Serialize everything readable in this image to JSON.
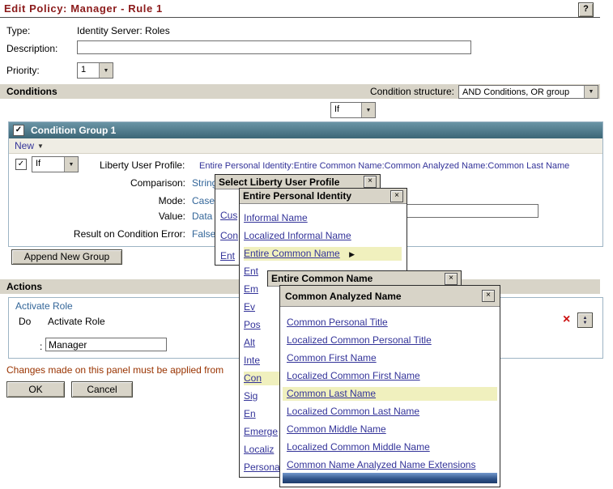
{
  "page": {
    "title": "Edit Policy: Manager - Rule 1"
  },
  "icons": {
    "help": "?",
    "close": "×",
    "dropdown": "▼",
    "submenu": "▶",
    "check": "✓",
    "delete": "×",
    "up": "▲",
    "down": "▼",
    "menu": "▼"
  },
  "form": {
    "type_label": "Type:",
    "type_value": "Identity Server: Roles",
    "description_label": "Description:",
    "description_value": "",
    "priority_label": "Priority:",
    "priority_value": "1"
  },
  "conditions": {
    "bar_label": "Conditions",
    "structure_label": "Condition structure:",
    "structure_value": "AND Conditions, OR group",
    "if_select": "If",
    "group": {
      "title": "Condition Group 1",
      "new_label": "New",
      "if_select": "If",
      "profile_label": "Liberty User Profile:",
      "profile_value": "Entire Personal Identity:Entire Common Name:Common Analyzed Name:Common Last Name",
      "comparison_label": "Comparison:",
      "comparison_value": "String",
      "mode_label": "Mode:",
      "mode_value": "Case S",
      "value_label": "Value:",
      "value_value": "Data E",
      "value_input": "",
      "error_label": "Result on Condition Error:",
      "error_value": "False"
    },
    "append_button": "Append New Group"
  },
  "actions": {
    "bar_label": "Actions",
    "panel_title": "Activate Role",
    "do_label": "Do",
    "do_value": "Activate Role",
    "param_label": ":",
    "param_value": "Manager"
  },
  "footer": {
    "note": "Changes made on this panel must be applied from",
    "ok_button": "OK",
    "cancel_button": "Cancel"
  },
  "popups": {
    "profile": {
      "title": "Select Liberty User Profile",
      "items": [
        {
          "label": "Cus"
        },
        {
          "label": "Con"
        },
        {
          "label": "Ent"
        }
      ]
    },
    "personal_identity": {
      "title": "Entire Personal Identity",
      "items": [
        {
          "label": "Informal Name"
        },
        {
          "label": "Localized Informal Name"
        },
        {
          "label": "Entire Common Name",
          "highlighted": true,
          "has_submenu": true
        },
        {
          "label": "Ent"
        },
        {
          "label": "Em"
        },
        {
          "label": "Ev"
        },
        {
          "label": "Pos"
        },
        {
          "label": "Alt"
        },
        {
          "label": "Inte"
        },
        {
          "label": "Con",
          "highlighted": true
        },
        {
          "label": "Sig"
        },
        {
          "label": "En"
        },
        {
          "label": "Emerge"
        },
        {
          "label": "Localiz"
        },
        {
          "label": "Persona"
        }
      ]
    },
    "common_name": {
      "title": "Entire Common Name"
    },
    "analyzed_name": {
      "title": "Common Analyzed Name",
      "items": [
        {
          "label": "Common Personal Title"
        },
        {
          "label": "Localized Common Personal Title"
        },
        {
          "label": "Common First Name"
        },
        {
          "label": "Localized Common First Name"
        },
        {
          "label": "Common Last Name",
          "highlighted": true
        },
        {
          "label": "Localized Common Last Name"
        },
        {
          "label": "Common Middle Name"
        },
        {
          "label": "Localized Common Middle Name"
        },
        {
          "label": "Common Name Analyzed Name Extensions"
        }
      ]
    }
  },
  "colors": {
    "title_text": "#8b1a1a",
    "section_bar": "#d8d4c8",
    "group_header_top": "#6b95a6",
    "group_header_bottom": "#3c6676",
    "link_blue": "#333399",
    "value_blue": "#336699",
    "highlight_yellow": "#f0f0be",
    "note_text": "#993300",
    "delete_red": "#cc1111",
    "popup_footer_blue": "#2d5187"
  }
}
